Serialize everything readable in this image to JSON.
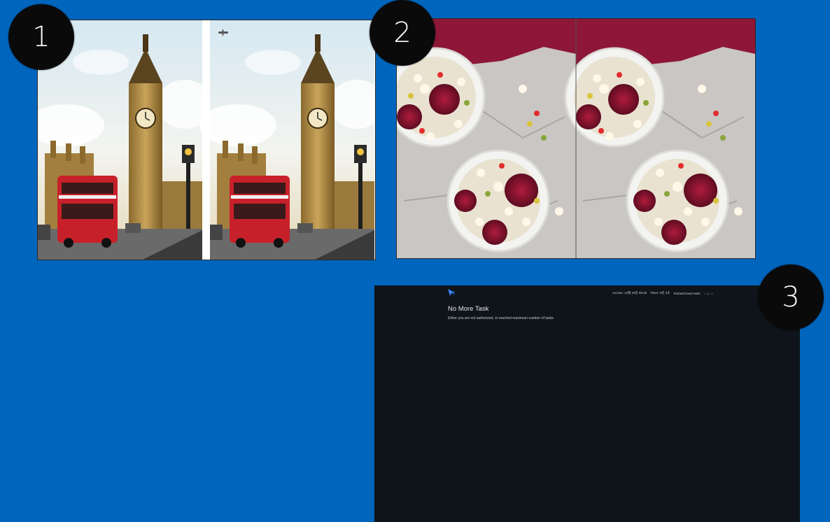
{
  "badges": {
    "b1": "1",
    "b2": "2",
    "b3": "3"
  },
  "panel1": {
    "description_icons": [
      "big-ben-photo-left",
      "big-ben-photo-right"
    ]
  },
  "panel2": {
    "description_icons": [
      "popcorn-bowls-photo-left",
      "popcorn-bowls-photo-right"
    ]
  },
  "task_screen": {
    "header": {
      "access_label": "Access:",
      "access_value": "12월 19일 09:25",
      "timer_label": "Timer:",
      "timer_value": "6분 3초",
      "user_name": "Richard Kwei Nash",
      "logout_label": "Logout"
    },
    "title": "No More Task",
    "subtitle": "Either you are not authorized, or reached maximum number of tasks"
  },
  "colors": {
    "background": "#0065bd",
    "badge": "#0a0a0a",
    "task_bg": "#0e1419",
    "bus_red": "#c8202a",
    "cloth": "#8e1738"
  }
}
